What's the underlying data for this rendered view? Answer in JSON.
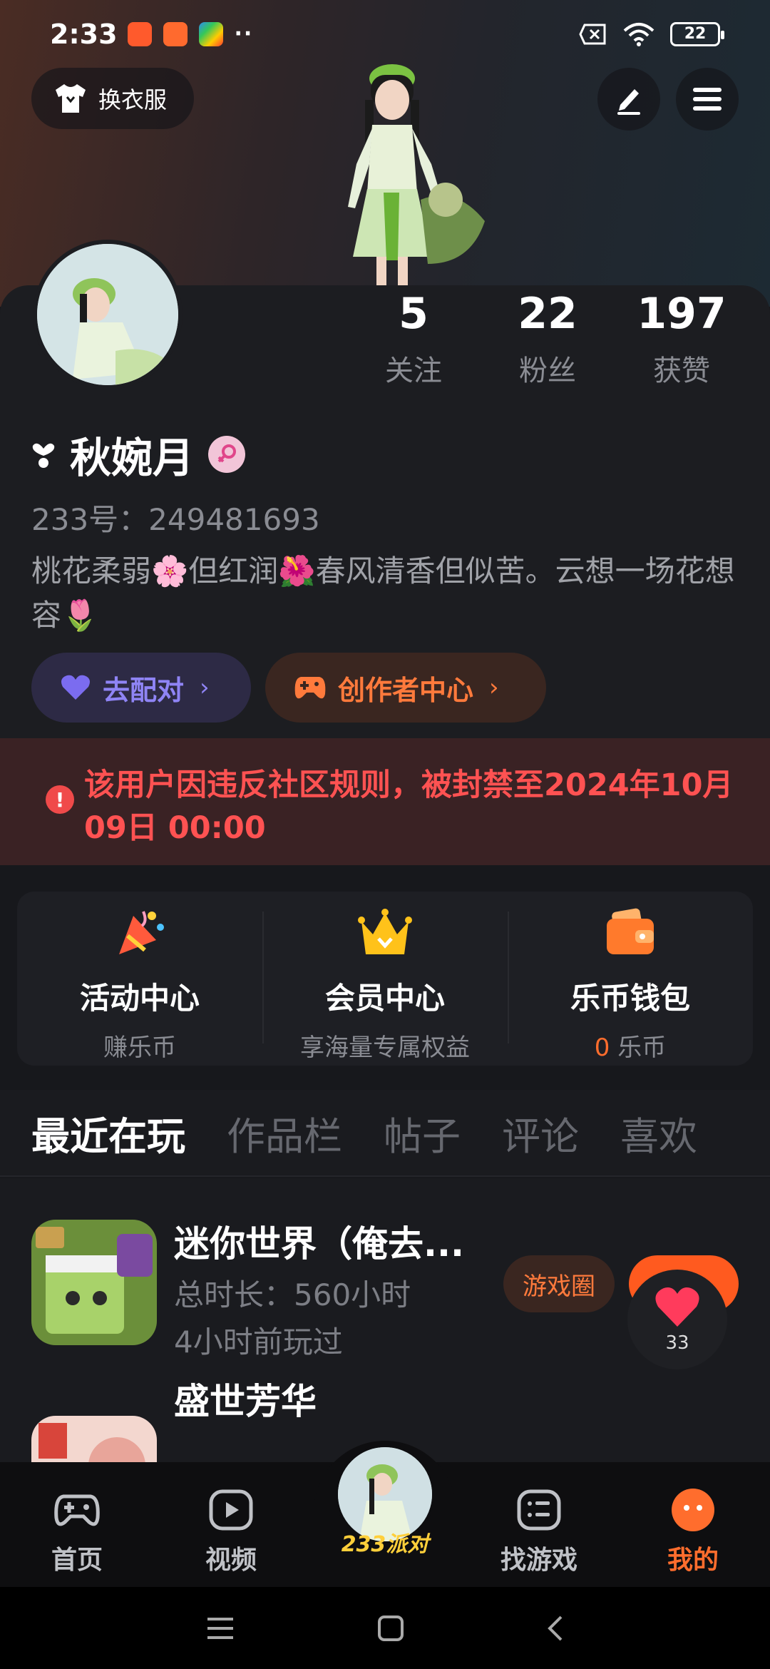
{
  "status": {
    "time": "2:33",
    "dots": "··",
    "battery": "22",
    "app_colors": [
      "#ff5a2c",
      "#ff6a2e",
      "#2c8cf0"
    ]
  },
  "header": {
    "outfit_label": "换衣服",
    "edit_icon": "pencil-icon",
    "menu_icon": "menu-icon"
  },
  "profile": {
    "stats": [
      {
        "value": "5",
        "label": "关注"
      },
      {
        "value": "22",
        "label": "粉丝"
      },
      {
        "value": "197",
        "label": "获赞"
      }
    ],
    "nickname": "秋婉月",
    "uid_label": "233号：",
    "uid": "249481693",
    "bio": "桃花柔弱🌸但红润🌺春风清香但似苦。云想一场花想容🌷",
    "match_label": "去配对",
    "creator_label": "创作者中心"
  },
  "ban": {
    "message": "该用户因违反社区规则，被封禁至2024年10月09日 00:00",
    "color": "#ff5252"
  },
  "features": [
    {
      "title": "活动中心",
      "sub": "赚乐币"
    },
    {
      "title": "会员中心",
      "sub": "享海量专属权益"
    },
    {
      "title": "乐币钱包",
      "sub_value": "0",
      "sub_unit": " 乐币"
    }
  ],
  "tabs": [
    "最近在玩",
    "作品栏",
    "帖子",
    "评论",
    "喜欢"
  ],
  "games": [
    {
      "title": "迷你世界（俺去...",
      "duration": "总时长：560小时",
      "last_played": "4小时前玩过",
      "circle_label": "游戏圈"
    },
    {
      "title": "盛世芳华"
    }
  ],
  "like_float": {
    "count": "33"
  },
  "bottom_nav": [
    {
      "label": "首页"
    },
    {
      "label": "视频"
    },
    {
      "label": "233派对"
    },
    {
      "label": "找游戏"
    },
    {
      "label": "我的"
    }
  ],
  "accent": "#ff6d2d"
}
